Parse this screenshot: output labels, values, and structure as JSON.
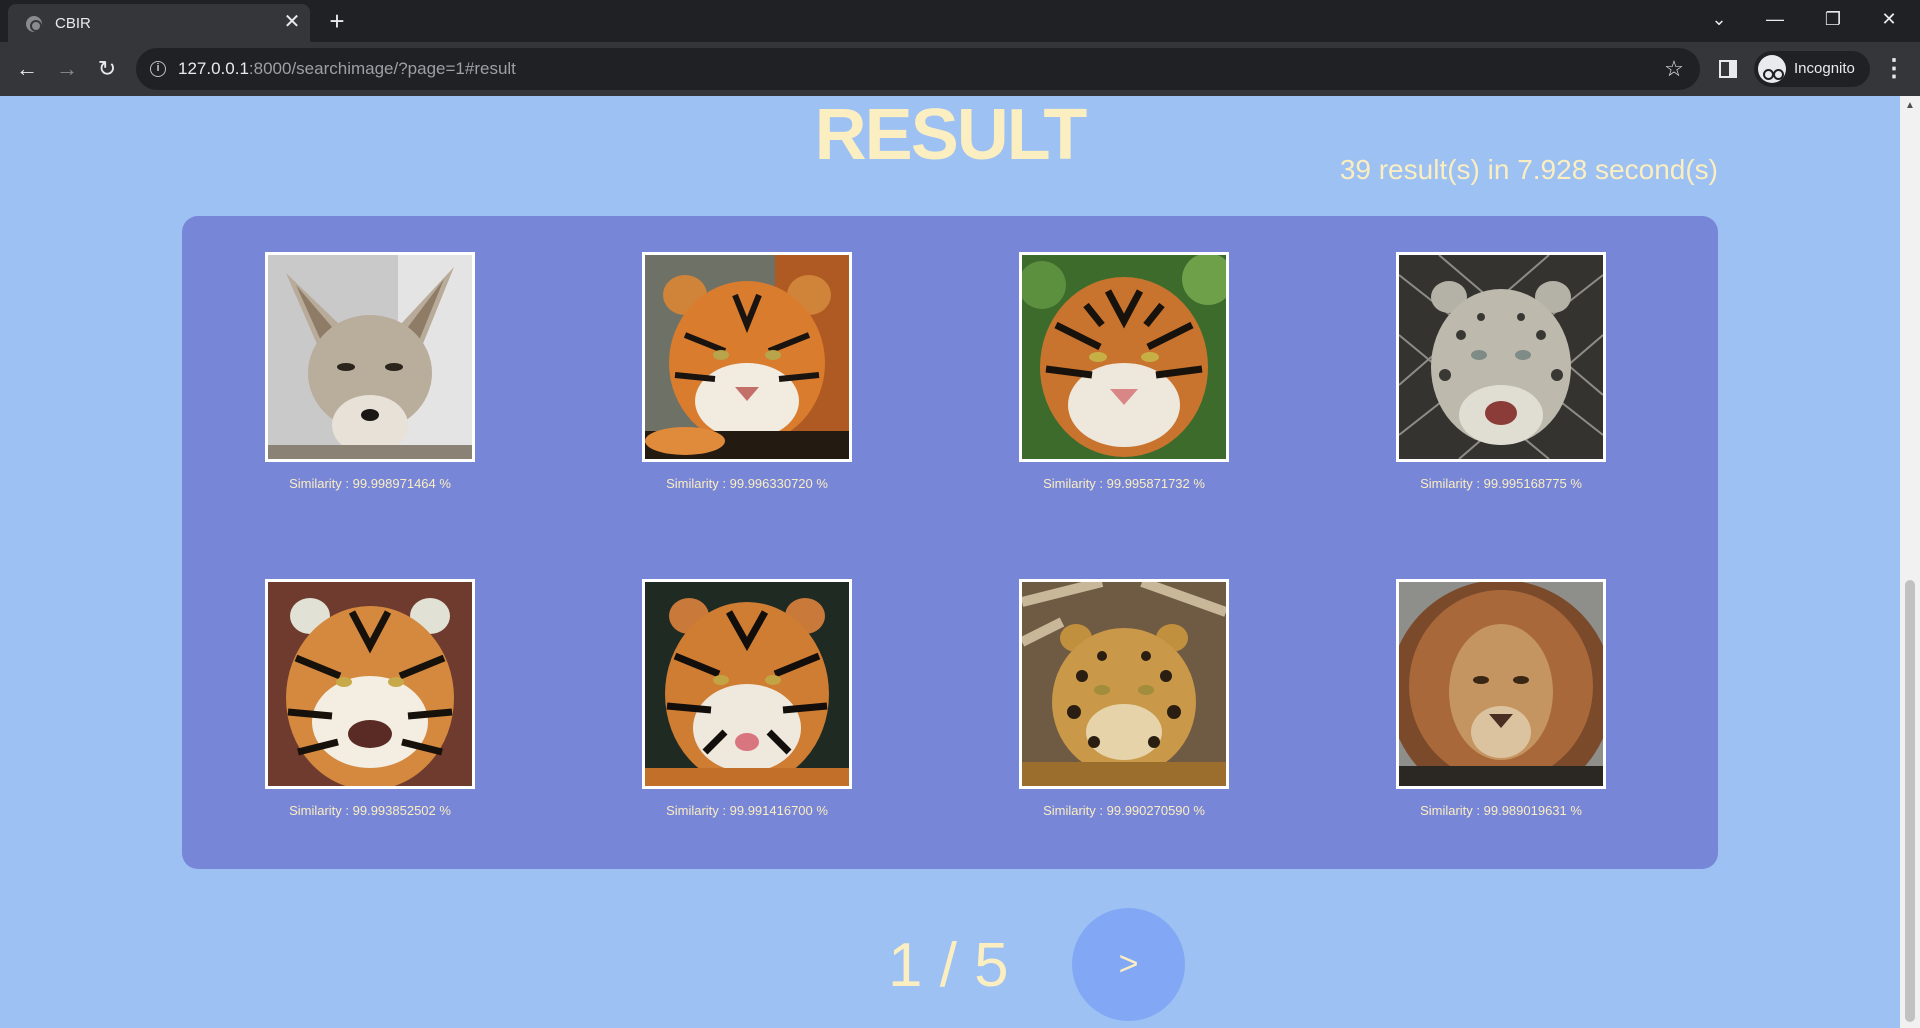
{
  "browser": {
    "tab_title": "CBIR",
    "tab_close": "✕",
    "new_tab": "+",
    "url_host": "127.0.0.1",
    "url_rest": ":8000/searchimage/?page=1#result",
    "profile_label": "Incognito",
    "win_controls": [
      "⌄",
      "—",
      "❐",
      "✕"
    ]
  },
  "page": {
    "title": "RESULT",
    "summary": "39 result(s) in 7.928 second(s)",
    "results": [
      {
        "similarity": "Similarity : 99.998971464 %",
        "animal": "fox"
      },
      {
        "similarity": "Similarity : 99.996330720 %",
        "animal": "tiger"
      },
      {
        "similarity": "Similarity : 99.995871732 %",
        "animal": "tiger"
      },
      {
        "similarity": "Similarity : 99.995168775 %",
        "animal": "snow-leopard"
      },
      {
        "similarity": "Similarity : 99.993852502 %",
        "animal": "tiger"
      },
      {
        "similarity": "Similarity : 99.991416700 %",
        "animal": "tiger"
      },
      {
        "similarity": "Similarity : 99.990270590 %",
        "animal": "jaguar"
      },
      {
        "similarity": "Similarity : 99.989019631 %",
        "animal": "lion"
      }
    ],
    "pagination": {
      "label": "1 / 5",
      "next_label": ">"
    }
  }
}
